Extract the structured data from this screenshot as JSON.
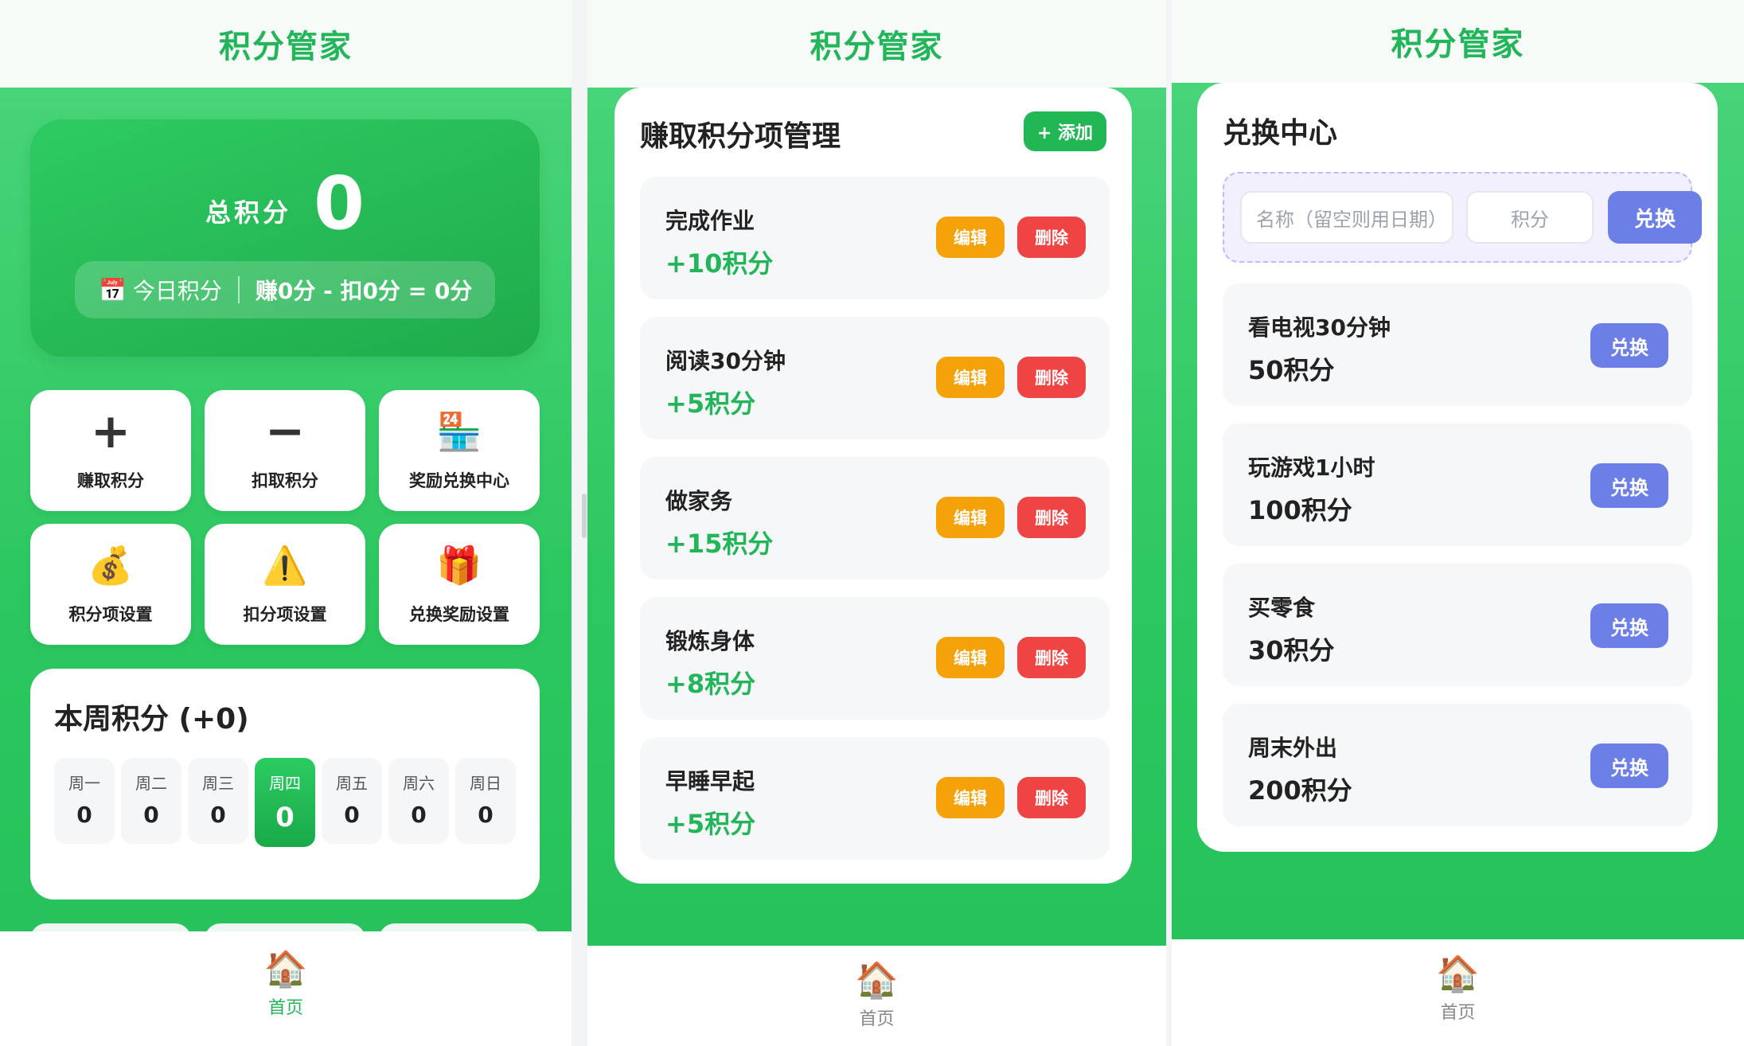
{
  "app_title": "积分管家",
  "nav": {
    "home_icon": "house-icon",
    "home_label": "首页"
  },
  "colors": {
    "accent_green": "#22b55a",
    "edit_orange": "#f5a20a",
    "delete_red": "#ef4444",
    "redeem_purple": "#6c7fe6"
  },
  "home": {
    "total_label": "总积分",
    "total_value": "0",
    "today_icon": "📅",
    "today_label": "今日积分",
    "today_formula": "赚0分 - 扣0分 = 0分",
    "tiles": [
      {
        "icon": "+",
        "label": "赚取积分"
      },
      {
        "icon": "−",
        "label": "扣取积分"
      },
      {
        "icon": "🏪",
        "label": "奖励兑换中心"
      },
      {
        "icon": "💰",
        "label": "积分项设置"
      },
      {
        "icon": "⚠️",
        "label": "扣分项设置"
      },
      {
        "icon": "🎁",
        "label": "兑换奖励设置"
      }
    ],
    "week": {
      "title": "本周积分 (+0)",
      "days": [
        {
          "name": "周一",
          "value": "0"
        },
        {
          "name": "周二",
          "value": "0"
        },
        {
          "name": "周三",
          "value": "0"
        },
        {
          "name": "周四",
          "value": "0"
        },
        {
          "name": "周五",
          "value": "0"
        },
        {
          "name": "周六",
          "value": "0"
        },
        {
          "name": "周日",
          "value": "0"
        }
      ],
      "active_day": "周四"
    }
  },
  "earn_manage": {
    "title": "赚取积分项管理",
    "add_label": "+ 添加",
    "edit_label": "编辑",
    "delete_label": "删除",
    "items": [
      {
        "name": "完成作业",
        "points": "+10积分"
      },
      {
        "name": "阅读30分钟",
        "points": "+5积分"
      },
      {
        "name": "做家务",
        "points": "+15积分"
      },
      {
        "name": "锻炼身体",
        "points": "+8积分"
      },
      {
        "name": "早睡早起",
        "points": "+5积分"
      }
    ]
  },
  "redeem": {
    "title": "兑换中心",
    "name_placeholder": "名称（留空则用日期）",
    "points_placeholder": "积分",
    "form_button": "兑换",
    "redeem_label": "兑换",
    "items": [
      {
        "name": "看电视30分钟",
        "cost": "50积分"
      },
      {
        "name": "玩游戏1小时",
        "cost": "100积分"
      },
      {
        "name": "买零食",
        "cost": "30积分"
      },
      {
        "name": "周末外出",
        "cost": "200积分"
      }
    ]
  }
}
